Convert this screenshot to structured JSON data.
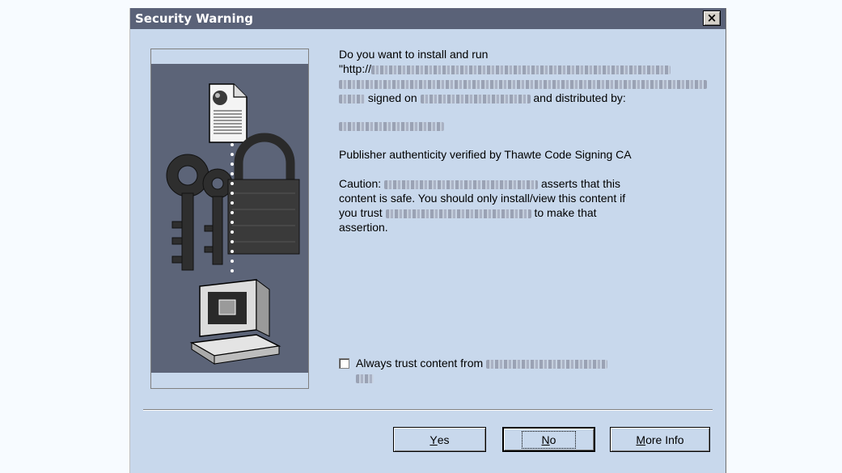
{
  "window": {
    "title": "Security Warning",
    "close_symbol": "×"
  },
  "body": {
    "line1": "Do you want to install and run",
    "url_prefix": "\"http://",
    "signed_on": "signed on",
    "distributed_by": "and distributed by:",
    "verified": "Publisher authenticity verified by Thawte Code Signing CA",
    "caution_label": "Caution:",
    "caution_asserts": "asserts that this",
    "caution_line2": "content is safe.  You should only install/view this content if",
    "you_trust": "you trust",
    "to_make_that": "to make that",
    "assertion": "assertion."
  },
  "checkbox": {
    "label_prefix": "Always trust content from",
    "checked": false
  },
  "buttons": {
    "yes": {
      "accel": "Y",
      "rest": "es"
    },
    "no": {
      "accel": "N",
      "rest": "o"
    },
    "more": {
      "accel": "M",
      "rest": "ore Info"
    }
  },
  "colors": {
    "titlebar": "#5a6278",
    "dialog_bg": "#c8d8ec",
    "art_bg": "#5c6478"
  }
}
